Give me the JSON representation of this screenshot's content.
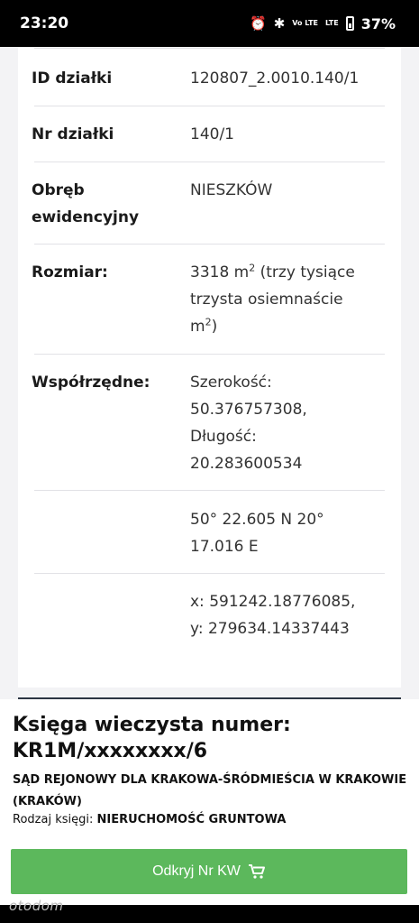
{
  "status_bar": {
    "time": "23:20",
    "network_label": "Vo LTE",
    "signal_label": "LTE",
    "battery_percent": "37%"
  },
  "plot_details": {
    "rows": [
      {
        "label": "ID działki",
        "value": "120807_2.0010.140/1"
      },
      {
        "label": "Nr działki",
        "value": "140/1"
      },
      {
        "label": "Obręb ewidencyjny",
        "value": "NIESZKÓW"
      },
      {
        "label": "Rozmiar:",
        "value_main": "3318 m",
        "value_sup": "2",
        "value_rest": " (trzy tysiące trzysta osiemnaście m",
        "value_sup2": "2",
        "value_end": ")"
      },
      {
        "label": "Współrzędne:",
        "value": "Szerokość: 50.376757308, Długość: 20.283600534"
      },
      {
        "label": "",
        "value": "50° 22.605 N 20° 17.016 E"
      },
      {
        "label": "",
        "value": "x: 591242.18776085, y: 279634.14337443"
      }
    ]
  },
  "land_register": {
    "title": "Księga wieczysta numer: KR1M/xxxxxxxx/6",
    "court": "SĄD REJONOWY DLA KRAKOWA-ŚRÓDMIEŚCIA W KRAKOWIE (KRAKÓW)",
    "type_label": "Rodzaj księgi:",
    "type_value": "NIERUCHOMOŚĆ GRUNTOWA",
    "button_label": "Odkryj Nr KW"
  },
  "brand": "otodom",
  "colors": {
    "button_green": "#5cb85c",
    "status_bar_bg": "#000000"
  }
}
